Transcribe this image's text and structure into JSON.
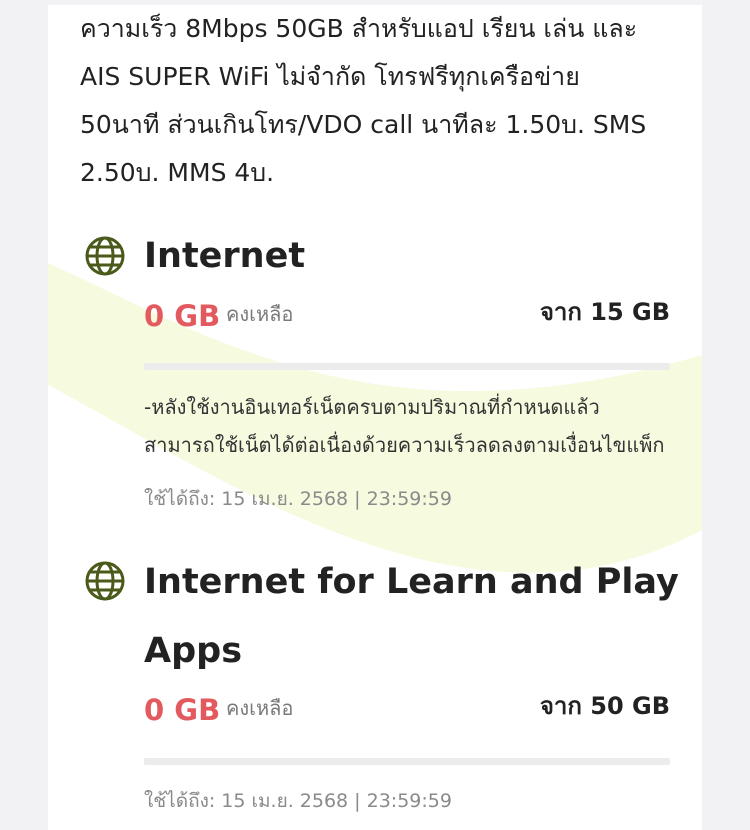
{
  "description": {
    "lines": [
      "ความเร็ว 8Mbps 50GB สำหรับแอป เรียน เล่น และ",
      "AIS SUPER WiFi ไม่จำกัด โทรฟรีทุกเครือข่าย",
      "50นาที ส่วนเกินโทร/VDO call นาทีละ 1.50บ. SMS",
      "2.50บ. MMS 4บ."
    ]
  },
  "packages": [
    {
      "icon": "globe-icon",
      "title_lines": [
        "Internet"
      ],
      "remaining": "0 GB",
      "remaining_label": "คงเหลือ",
      "total": "จาก 15 GB",
      "usage_fraction_remaining": 0,
      "note_lines": [
        "-หลังใช้งานอินเทอร์เน็ตครบตามปริมาณที่กำหนดแล้ว",
        "สามารถใช้เน็ตได้ต่อเนื่องด้วยความเร็วลดลงตามเงื่อนไขแพ็ก"
      ],
      "expiry": "ใช้ได้ถึง: 15 เม.ย. 2568 | 23:59:59"
    },
    {
      "icon": "globe-icon",
      "title_lines": [
        "Internet for Learn and Play",
        "Apps"
      ],
      "remaining": "0 GB",
      "remaining_label": "คงเหลือ",
      "total": "จาก 50 GB",
      "usage_fraction_remaining": 0,
      "expiry": "ใช้ได้ถึง: 15 เม.ย. 2568 | 23:59:59"
    }
  ],
  "colors": {
    "remaining_red": "#e35a5e",
    "icon_green": "#4a5a1a",
    "accent_lime": "#b2d234",
    "bar_track": "#ececec"
  }
}
